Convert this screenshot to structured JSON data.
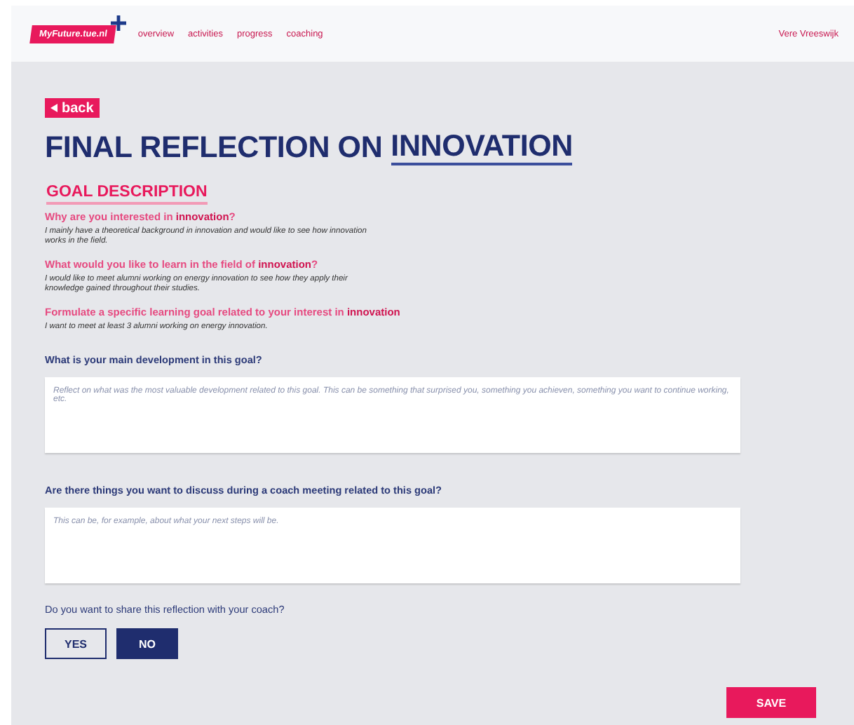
{
  "header": {
    "logo": "MyFuture.tue.nl",
    "nav": [
      {
        "label": "overview"
      },
      {
        "label": "activities"
      },
      {
        "label": "progress"
      },
      {
        "label": "coaching"
      }
    ],
    "user": "Vere Vreeswijk"
  },
  "back": "back",
  "title": {
    "prefix": "FINAL REFLECTION ON",
    "topic": "INNOVATION"
  },
  "goal_description": {
    "heading": "GOAL DESCRIPTION",
    "items": [
      {
        "question": "Why are you interested in **innovation**?",
        "answer": "I mainly have a theoretical background in innovation and would like to see how innovation works in the field."
      },
      {
        "question": "What would you like to learn in the field of **innovation**?",
        "answer": "I would like to meet alumni working on energy innovation to see how they apply their knowledge gained throughout their studies."
      },
      {
        "question": "Formulate a specific learning goal related to your interest in **innovation**",
        "answer": "I want to meet at least 3 alumni working on energy innovation."
      }
    ]
  },
  "fields": [
    {
      "label": "What is your main development in this goal?",
      "placeholder": "Reflect on what was the most valuable development related to this goal. This can be something that surprised you, something you achieven, something you want to continue working, etc."
    },
    {
      "label": "Are there things you want to discuss during a coach meeting related to this goal?",
      "placeholder": "This can be, for example, about what your next steps will be."
    }
  ],
  "share": {
    "question": "Do you want to share this reflection with your coach?",
    "options": [
      {
        "label": "YES",
        "selected": false
      },
      {
        "label": "NO",
        "selected": true
      }
    ]
  },
  "save": "SAVE"
}
